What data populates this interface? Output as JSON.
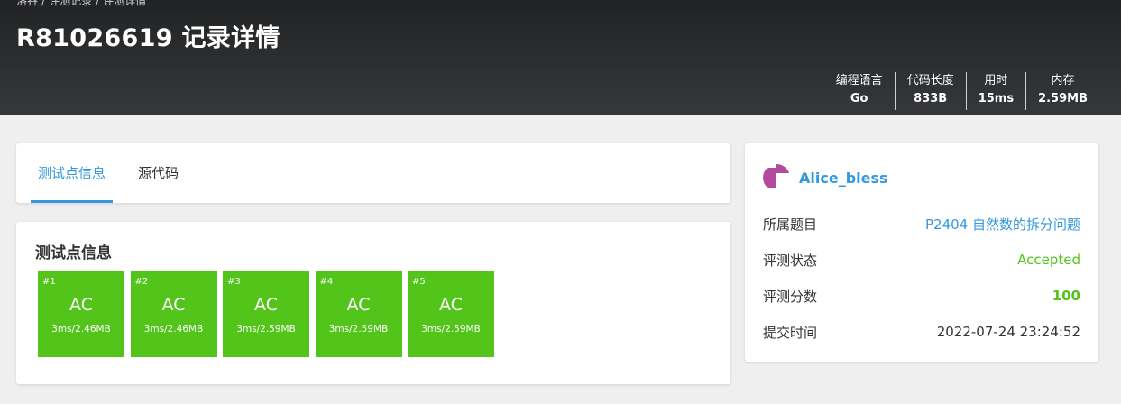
{
  "breadcrumb": [
    "洛谷",
    "/",
    "评测记录",
    "/",
    "评测详情"
  ],
  "title": "R81026619 记录详情",
  "stats": [
    {
      "label": "编程语言",
      "value": "Go"
    },
    {
      "label": "代码长度",
      "value": "833B"
    },
    {
      "label": "用时",
      "value": "15ms"
    },
    {
      "label": "内存",
      "value": "2.59MB"
    }
  ],
  "tabs": [
    "测试点信息",
    "源代码"
  ],
  "section_title": "测试点信息",
  "testcases": [
    {
      "id": "#1",
      "status": "AC",
      "detail": "3ms/2.46MB"
    },
    {
      "id": "#2",
      "status": "AC",
      "detail": "3ms/2.46MB"
    },
    {
      "id": "#3",
      "status": "AC",
      "detail": "3ms/2.59MB"
    },
    {
      "id": "#4",
      "status": "AC",
      "detail": "3ms/2.59MB"
    },
    {
      "id": "#5",
      "status": "AC",
      "detail": "3ms/2.59MB"
    }
  ],
  "user": {
    "name": "Alice_bless"
  },
  "info": [
    {
      "key": "所属题目",
      "value": "P2404 自然数的拆分问题"
    },
    {
      "key": "评测状态",
      "value": "Accepted"
    },
    {
      "key": "评测分数",
      "value": "100"
    },
    {
      "key": "提交时间",
      "value": "2022-07-24 23:24:52"
    }
  ],
  "colors": {
    "accent": "#3498db",
    "accepted": "#52c41a",
    "header_bg": "#2a2b2d",
    "avatar": "#b44a9e"
  },
  "icons": {
    "avatar": "user-avatar"
  }
}
